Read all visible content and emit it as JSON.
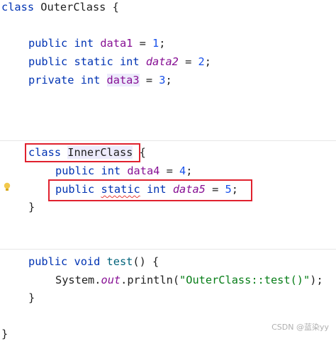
{
  "code": {
    "kw_class": "class",
    "outer_class_name": "OuterClass",
    "open_brace": " {",
    "close_brace": "}",
    "kw_public": "public",
    "kw_private": "private",
    "kw_static": "static",
    "kw_int": "int",
    "kw_void": "void",
    "data1": "data1",
    "data2": "data2",
    "data3": "data3",
    "data4": "data4",
    "data5": "data5",
    "val1": "1",
    "val2": "2",
    "val3": "3",
    "val4": "4",
    "val5": "5",
    "inner_class_name": "InnerClass",
    "method_name": "test",
    "system": "System",
    "out": "out",
    "println": "println",
    "string_literal": "\"OuterClass::test()\""
  },
  "watermark": "CSDN @蓝染yy",
  "colors": {
    "keyword": "#0033b3",
    "field": "#871094",
    "number": "#1750eb",
    "string": "#067d17",
    "highlight_box": "#e0212e"
  },
  "icons": {
    "gutter": "lightbulb-icon"
  }
}
